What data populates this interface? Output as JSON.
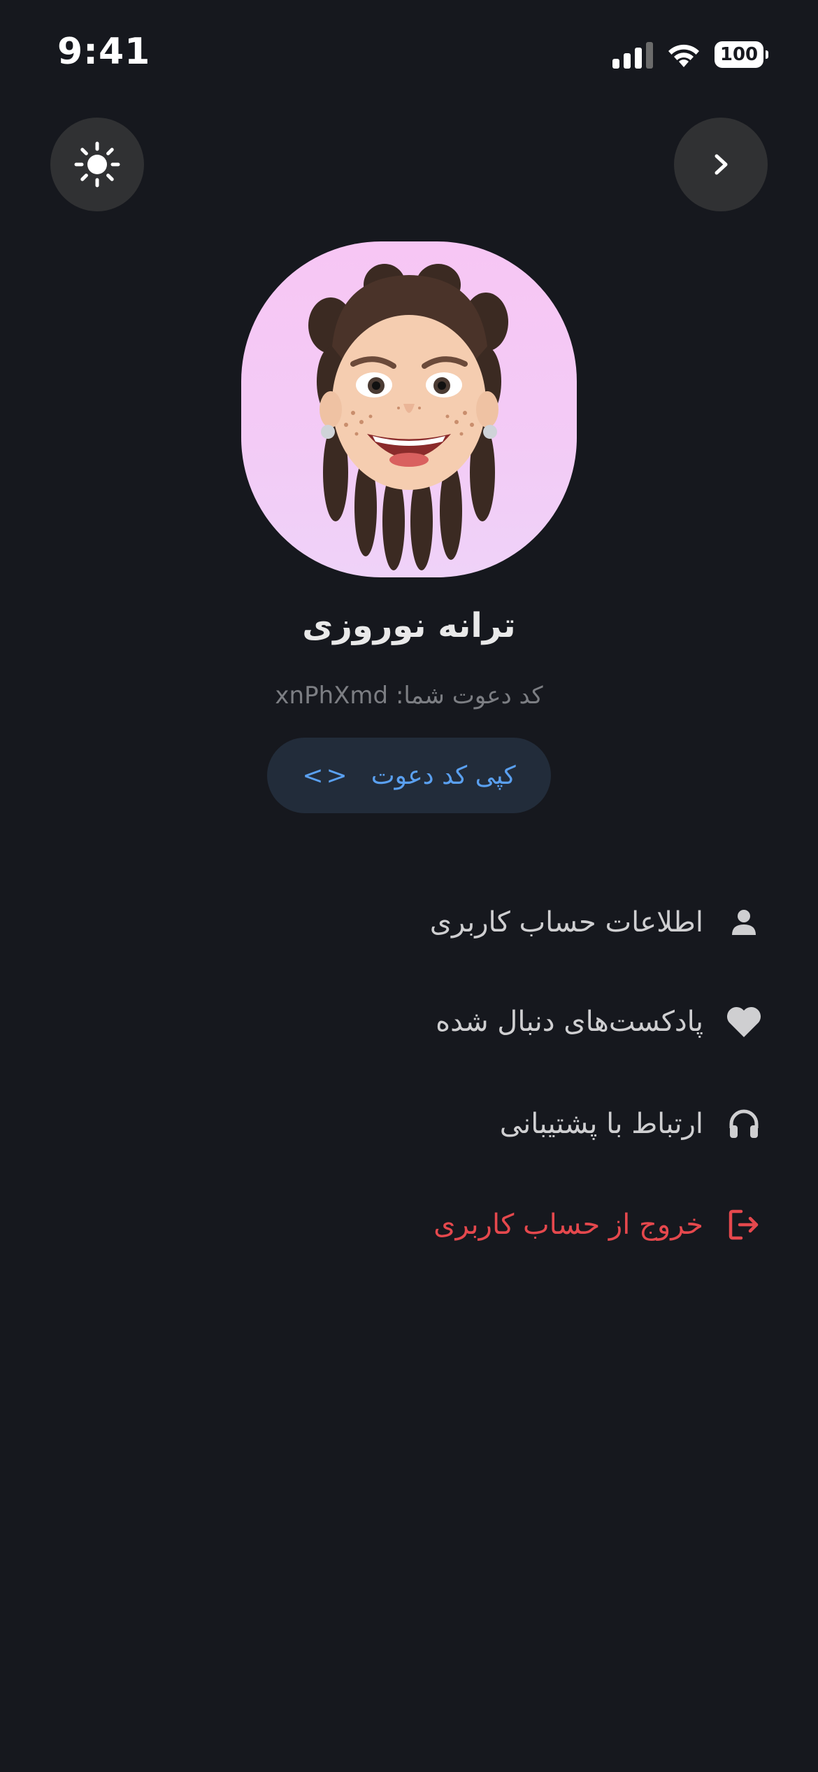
{
  "status_bar": {
    "time": "9:41",
    "battery": "100"
  },
  "header": {
    "theme_icon": "sun-icon",
    "forward_icon": "chevron-right-icon"
  },
  "profile": {
    "avatar": "memoji-avatar",
    "name": "ترانه نوروزی",
    "invite_text": "کد دعوت شما: xnPhXmd",
    "copy_button_label": "کپی کد دعوت",
    "copy_button_icon": "<>"
  },
  "menu": {
    "items": [
      {
        "label": "اطلاعات حساب کاربری",
        "icon": "user-icon"
      },
      {
        "label": "پادکست‌های دنبال شده",
        "icon": "heart-icon"
      },
      {
        "label": "ارتباط با پشتیبانی",
        "icon": "headphones-icon"
      },
      {
        "label": "خروج از حساب کاربری",
        "icon": "logout-icon",
        "color": "#e5484d"
      }
    ]
  },
  "colors": {
    "background": "#16181e",
    "accent": "#5aa0f0",
    "danger": "#e5484d"
  }
}
